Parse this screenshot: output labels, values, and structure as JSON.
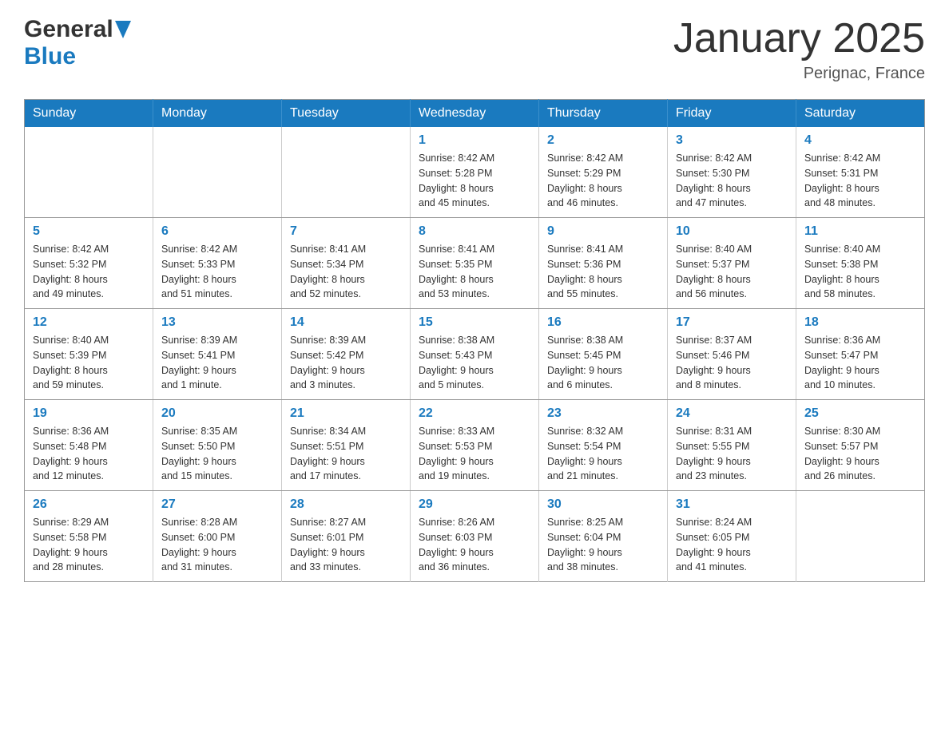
{
  "logo": {
    "line1": "General",
    "line2": "Blue"
  },
  "title": "January 2025",
  "subtitle": "Perignac, France",
  "days_of_week": [
    "Sunday",
    "Monday",
    "Tuesday",
    "Wednesday",
    "Thursday",
    "Friday",
    "Saturday"
  ],
  "weeks": [
    [
      {
        "day": "",
        "info": ""
      },
      {
        "day": "",
        "info": ""
      },
      {
        "day": "",
        "info": ""
      },
      {
        "day": "1",
        "info": "Sunrise: 8:42 AM\nSunset: 5:28 PM\nDaylight: 8 hours\nand 45 minutes."
      },
      {
        "day": "2",
        "info": "Sunrise: 8:42 AM\nSunset: 5:29 PM\nDaylight: 8 hours\nand 46 minutes."
      },
      {
        "day": "3",
        "info": "Sunrise: 8:42 AM\nSunset: 5:30 PM\nDaylight: 8 hours\nand 47 minutes."
      },
      {
        "day": "4",
        "info": "Sunrise: 8:42 AM\nSunset: 5:31 PM\nDaylight: 8 hours\nand 48 minutes."
      }
    ],
    [
      {
        "day": "5",
        "info": "Sunrise: 8:42 AM\nSunset: 5:32 PM\nDaylight: 8 hours\nand 49 minutes."
      },
      {
        "day": "6",
        "info": "Sunrise: 8:42 AM\nSunset: 5:33 PM\nDaylight: 8 hours\nand 51 minutes."
      },
      {
        "day": "7",
        "info": "Sunrise: 8:41 AM\nSunset: 5:34 PM\nDaylight: 8 hours\nand 52 minutes."
      },
      {
        "day": "8",
        "info": "Sunrise: 8:41 AM\nSunset: 5:35 PM\nDaylight: 8 hours\nand 53 minutes."
      },
      {
        "day": "9",
        "info": "Sunrise: 8:41 AM\nSunset: 5:36 PM\nDaylight: 8 hours\nand 55 minutes."
      },
      {
        "day": "10",
        "info": "Sunrise: 8:40 AM\nSunset: 5:37 PM\nDaylight: 8 hours\nand 56 minutes."
      },
      {
        "day": "11",
        "info": "Sunrise: 8:40 AM\nSunset: 5:38 PM\nDaylight: 8 hours\nand 58 minutes."
      }
    ],
    [
      {
        "day": "12",
        "info": "Sunrise: 8:40 AM\nSunset: 5:39 PM\nDaylight: 8 hours\nand 59 minutes."
      },
      {
        "day": "13",
        "info": "Sunrise: 8:39 AM\nSunset: 5:41 PM\nDaylight: 9 hours\nand 1 minute."
      },
      {
        "day": "14",
        "info": "Sunrise: 8:39 AM\nSunset: 5:42 PM\nDaylight: 9 hours\nand 3 minutes."
      },
      {
        "day": "15",
        "info": "Sunrise: 8:38 AM\nSunset: 5:43 PM\nDaylight: 9 hours\nand 5 minutes."
      },
      {
        "day": "16",
        "info": "Sunrise: 8:38 AM\nSunset: 5:45 PM\nDaylight: 9 hours\nand 6 minutes."
      },
      {
        "day": "17",
        "info": "Sunrise: 8:37 AM\nSunset: 5:46 PM\nDaylight: 9 hours\nand 8 minutes."
      },
      {
        "day": "18",
        "info": "Sunrise: 8:36 AM\nSunset: 5:47 PM\nDaylight: 9 hours\nand 10 minutes."
      }
    ],
    [
      {
        "day": "19",
        "info": "Sunrise: 8:36 AM\nSunset: 5:48 PM\nDaylight: 9 hours\nand 12 minutes."
      },
      {
        "day": "20",
        "info": "Sunrise: 8:35 AM\nSunset: 5:50 PM\nDaylight: 9 hours\nand 15 minutes."
      },
      {
        "day": "21",
        "info": "Sunrise: 8:34 AM\nSunset: 5:51 PM\nDaylight: 9 hours\nand 17 minutes."
      },
      {
        "day": "22",
        "info": "Sunrise: 8:33 AM\nSunset: 5:53 PM\nDaylight: 9 hours\nand 19 minutes."
      },
      {
        "day": "23",
        "info": "Sunrise: 8:32 AM\nSunset: 5:54 PM\nDaylight: 9 hours\nand 21 minutes."
      },
      {
        "day": "24",
        "info": "Sunrise: 8:31 AM\nSunset: 5:55 PM\nDaylight: 9 hours\nand 23 minutes."
      },
      {
        "day": "25",
        "info": "Sunrise: 8:30 AM\nSunset: 5:57 PM\nDaylight: 9 hours\nand 26 minutes."
      }
    ],
    [
      {
        "day": "26",
        "info": "Sunrise: 8:29 AM\nSunset: 5:58 PM\nDaylight: 9 hours\nand 28 minutes."
      },
      {
        "day": "27",
        "info": "Sunrise: 8:28 AM\nSunset: 6:00 PM\nDaylight: 9 hours\nand 31 minutes."
      },
      {
        "day": "28",
        "info": "Sunrise: 8:27 AM\nSunset: 6:01 PM\nDaylight: 9 hours\nand 33 minutes."
      },
      {
        "day": "29",
        "info": "Sunrise: 8:26 AM\nSunset: 6:03 PM\nDaylight: 9 hours\nand 36 minutes."
      },
      {
        "day": "30",
        "info": "Sunrise: 8:25 AM\nSunset: 6:04 PM\nDaylight: 9 hours\nand 38 minutes."
      },
      {
        "day": "31",
        "info": "Sunrise: 8:24 AM\nSunset: 6:05 PM\nDaylight: 9 hours\nand 41 minutes."
      },
      {
        "day": "",
        "info": ""
      }
    ]
  ]
}
